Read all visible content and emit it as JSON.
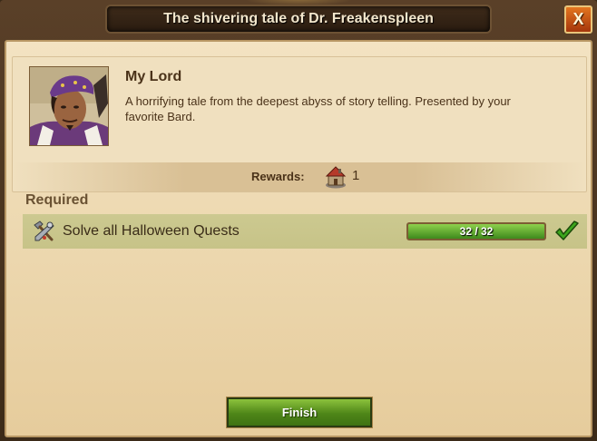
{
  "window": {
    "title": "The shivering tale of Dr. Freakenspleen",
    "close_label": "X"
  },
  "quest": {
    "giver_name": "My Lord",
    "description": "A horrifying tale from the deepest abyss of story telling. Presented by your favorite Bard.",
    "portrait_icon": "bard-portrait",
    "rewards": {
      "label": "Rewards:",
      "items": [
        {
          "icon": "house-reward-icon",
          "amount": "1"
        }
      ]
    }
  },
  "requirements": {
    "heading": "Required",
    "items": [
      {
        "icon": "tools-icon",
        "text": "Solve all Halloween Quests",
        "progress_text": "32 / 32",
        "progress_fraction": 1.0,
        "completed": true
      }
    ]
  },
  "footer": {
    "finish_label": "Finish"
  },
  "colors": {
    "accent_green": "#4e8618",
    "close_orange": "#c95416",
    "parchment": "#ecd7ae"
  }
}
